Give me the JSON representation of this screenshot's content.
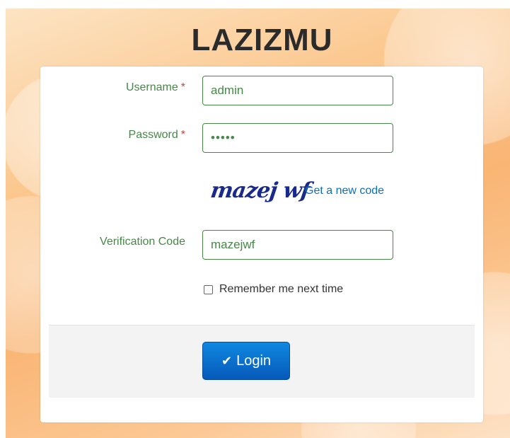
{
  "app": {
    "title": "LAZIZMU"
  },
  "form": {
    "username": {
      "label": "Username",
      "required_mark": "*",
      "value": "admin"
    },
    "password": {
      "label": "Password",
      "required_mark": "*",
      "value": "•••••"
    },
    "captcha": {
      "image_text": "mazej wf",
      "refresh_link": "Get a new code"
    },
    "verification": {
      "label": "Verification Code",
      "value": "mazejwf"
    },
    "remember": {
      "label": "Remember me next time",
      "checked": false
    },
    "login_button": {
      "label": "Login",
      "icon": "check-icon"
    }
  },
  "colors": {
    "label_success": "#468847",
    "required": "#b94a48",
    "link": "#0e6fb5",
    "button_primary": "#0659b9"
  }
}
